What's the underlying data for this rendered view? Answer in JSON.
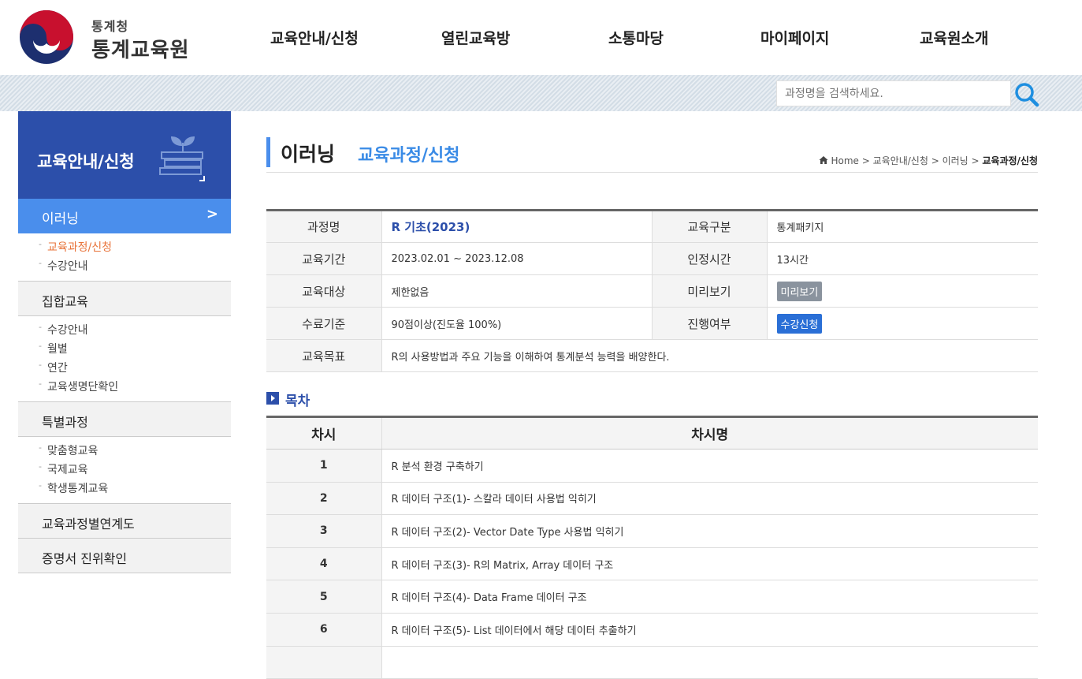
{
  "header": {
    "org_small": "통계청",
    "org_big": "통계교육원",
    "nav": [
      "교육안내/신청",
      "열린교육방",
      "소통마당",
      "마이페이지",
      "교육원소개"
    ]
  },
  "search": {
    "placeholder": "과정명을 검색하세요."
  },
  "sidebar": {
    "heading": "교육안내/신청",
    "active": "이러닝",
    "active_subs": [
      {
        "label": "교육과정/신청",
        "selected": true
      },
      {
        "label": "수강안내",
        "selected": false
      }
    ],
    "groups": [
      {
        "label": "집합교육",
        "subs": [
          "수강안내",
          "월별",
          "연간",
          "교육생명단확인"
        ]
      },
      {
        "label": "특별과정",
        "subs": [
          "맞춤형교육",
          "국제교육",
          "학생통계교육"
        ]
      },
      {
        "label": "교육과정별연계도",
        "subs": []
      },
      {
        "label": "증명서 진위확인",
        "subs": []
      }
    ]
  },
  "page": {
    "title": "이러닝",
    "subtitle": "교육과정/신청",
    "breadcrumb": [
      "Home",
      "교육안내/신청",
      "이러닝",
      "교육과정/신청"
    ]
  },
  "info": {
    "course_label": "과정명",
    "course": "R 기초(2023)",
    "type_label": "교육구분",
    "type": "통계패키지",
    "period_label": "교육기간",
    "period": "2023.02.01 ~ 2023.12.08",
    "hours_label": "인정시간",
    "hours": "13시간",
    "target_label": "교육대상",
    "target": "제한없음",
    "preview_label": "미리보기",
    "preview_btn": "미리보기",
    "criteria_label": "수료기준",
    "criteria": "90점이상(진도율 100%)",
    "status_label": "진행여부",
    "apply_btn": "수강신청",
    "goal_label": "교육목표",
    "goal": "R의 사용방법과 주요 기능을 이해하여 통계분석 능력을 배양한다."
  },
  "toc": {
    "title": "목차",
    "col_no": "차시",
    "col_name": "차시명",
    "rows": [
      {
        "no": "1",
        "name": "R 분석 환경 구축하기"
      },
      {
        "no": "2",
        "name": "R 데이터 구조(1)- 스칼라 데이터 사용법 익히기"
      },
      {
        "no": "3",
        "name": "R 데이터 구조(2)- Vector Date Type 사용법 익히기"
      },
      {
        "no": "4",
        "name": "R 데이터 구조(3)- R의 Matrix, Array 데이터 구조"
      },
      {
        "no": "5",
        "name": "R 데이터 구조(4)- Data Frame 데이터 구조"
      },
      {
        "no": "6",
        "name": "R 데이터 구조(5)- List 데이터에서 해당 데이터 추출하기"
      },
      {
        "no": "",
        "name": ""
      }
    ]
  }
}
